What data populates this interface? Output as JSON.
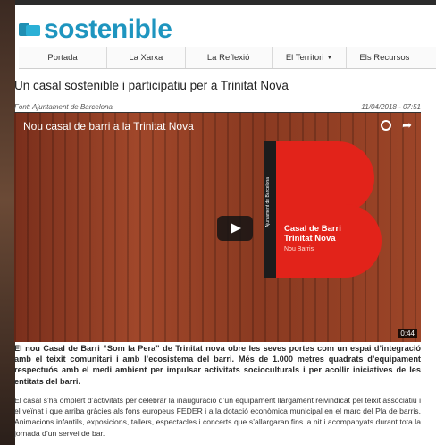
{
  "site": {
    "logo_text": "sostenible",
    "brand_color": "#1e95bf"
  },
  "nav": {
    "items": [
      {
        "label": "Portada"
      },
      {
        "label": "La Xarxa"
      },
      {
        "label": "La Reflexió"
      },
      {
        "label": "El Territori",
        "has_dropdown": true
      },
      {
        "label": "Els Recursos"
      }
    ]
  },
  "article": {
    "title": "Un casal sostenible i participatiu per a Trinitat Nova",
    "source": "Font: Ajuntament de Barcelona",
    "date": "11/04/2018 - 07:51",
    "video": {
      "title": "Nou casal de barri a la Trinitat Nova",
      "duration": "0:44",
      "sign_lines": [
        "Casal de Barri",
        "Trinitat Nova"
      ],
      "sign_district": "Nou Barris",
      "sign_vertical_text": "Ajuntament de Barcelona"
    },
    "lead": "El nou Casal de Barri “Som la Pera” de Trinitat nova obre les seves portes com un espai d’integració amb el teixit comunitari i amb l’ecosistema del barri. Més de 1.000 metres quadrats d’equipament respectuós amb el medi ambient per impulsar activitats socioculturals i per acollir iniciatives de les entitats del barri.",
    "body": "El casal s’ha omplert d’activitats per celebrar la inauguració d’un equipament llargament reivindicat pel teixit associatiu i el veïnat i que arriba gràcies als fons europeus FEDER i a la dotació econòmica municipal en el marc del Pla de barris. Animacions infantils, exposicions, tallers, espectacles i concerts que s’allargaran fins la nit i acompanyats durant tota la jornada d’un servei de bar."
  }
}
